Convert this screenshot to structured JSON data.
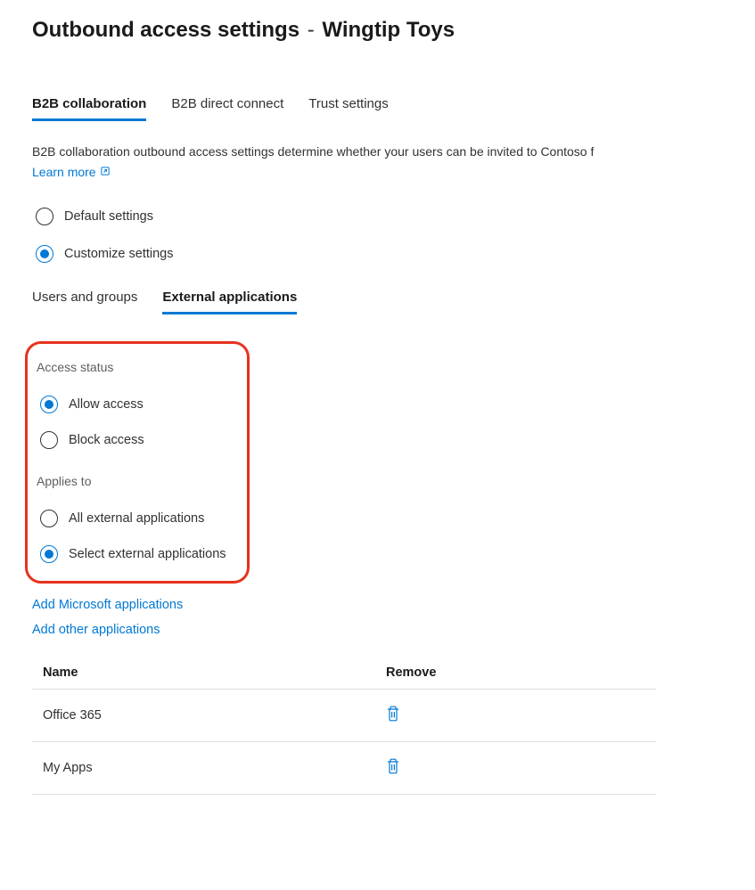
{
  "header": {
    "title_prefix": "Outbound access settings",
    "title_separator": "-",
    "organization": "Wingtip Toys"
  },
  "main_tabs": [
    {
      "label": "B2B collaboration",
      "active": true
    },
    {
      "label": "B2B direct connect",
      "active": false
    },
    {
      "label": "Trust settings",
      "active": false
    }
  ],
  "description": "B2B collaboration outbound access settings determine whether your users can be invited to Contoso f",
  "learn_more": "Learn more",
  "settings_mode": {
    "options": [
      {
        "label": "Default settings",
        "selected": false
      },
      {
        "label": "Customize settings",
        "selected": true
      }
    ]
  },
  "sub_tabs": [
    {
      "label": "Users and groups",
      "active": false
    },
    {
      "label": "External applications",
      "active": true
    }
  ],
  "access_status": {
    "label": "Access status",
    "options": [
      {
        "label": "Allow access",
        "selected": true
      },
      {
        "label": "Block access",
        "selected": false
      }
    ]
  },
  "applies_to": {
    "label": "Applies to",
    "options": [
      {
        "label": "All external applications",
        "selected": false
      },
      {
        "label": "Select external applications",
        "selected": true
      }
    ]
  },
  "actions": {
    "add_microsoft": "Add Microsoft applications",
    "add_other": "Add other applications"
  },
  "table": {
    "columns": {
      "name": "Name",
      "remove": "Remove"
    },
    "rows": [
      {
        "name": "Office 365"
      },
      {
        "name": "My Apps"
      }
    ]
  }
}
